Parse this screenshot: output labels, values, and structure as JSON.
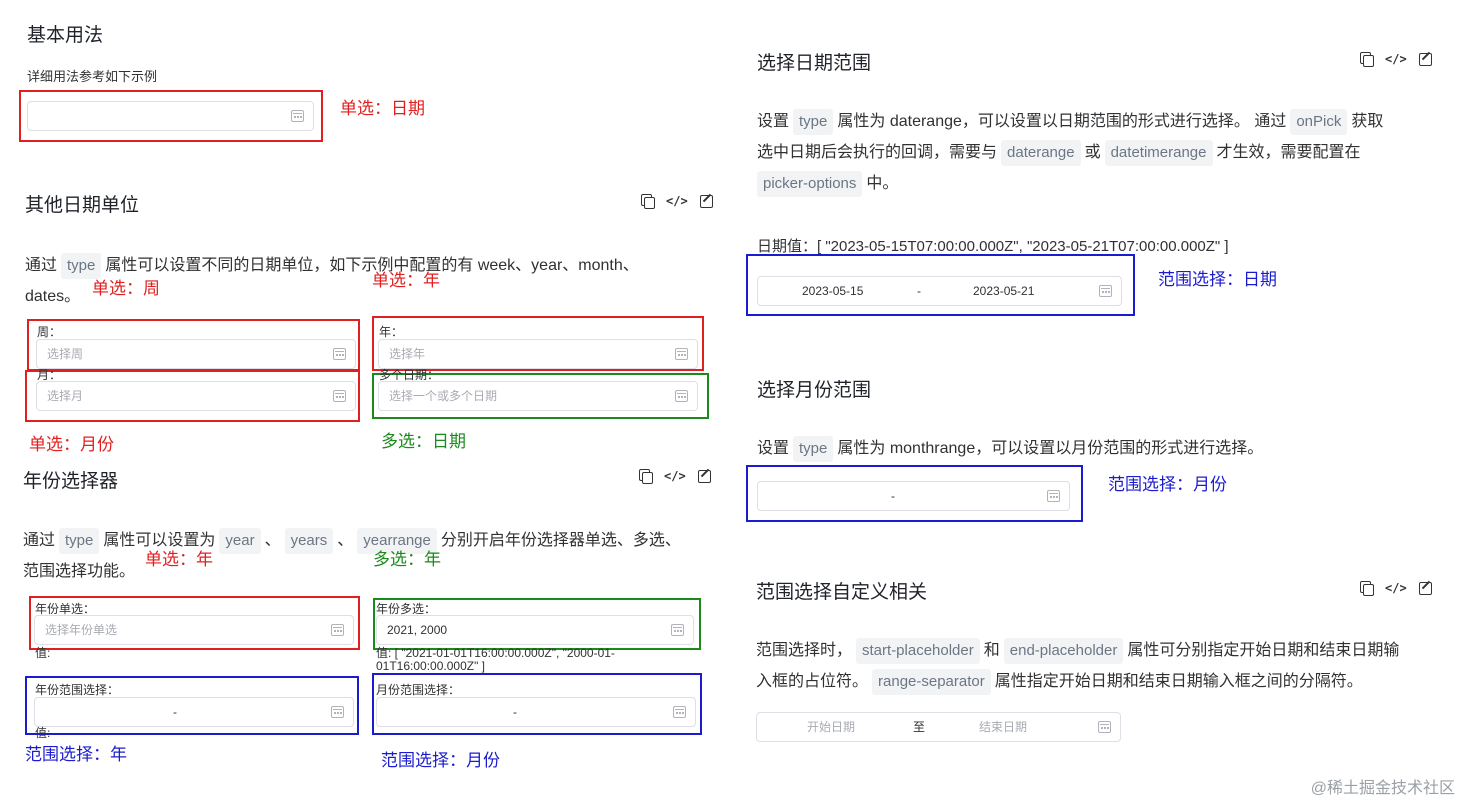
{
  "basic": {
    "title": "基本用法",
    "desc": "详细用法参考如下示例",
    "ann": "单选：日期"
  },
  "other_units": {
    "title": "其他日期单位",
    "desc_prefix": "通过",
    "desc_code": "type",
    "desc_rest": "属性可以设置不同的日期单位，如下示例中配置的有 week、year、month、",
    "desc_line2": "dates。",
    "week_label": "周：",
    "week_placeholder": "选择周",
    "year_label": "年：",
    "year_placeholder": "选择年",
    "month_label": "月：",
    "month_placeholder": "选择月",
    "dates_label": "多个日期：",
    "dates_placeholder": "选择一个或多个日期",
    "ann_week": "单选：周",
    "ann_year": "单选：年",
    "ann_month": "单选：月份",
    "ann_dates": "多选：日期"
  },
  "year_picker": {
    "title": "年份选择器",
    "desc_prefix": "通过",
    "code_type": "type",
    "desc_mid": "属性可以设置为",
    "code_year": "year",
    "sep1": "、",
    "code_years": "years",
    "sep2": "、",
    "code_yearrange": "yearrange",
    "desc_rest": "分别开启年份选择器单选、多选、",
    "desc_line2": "范围选择功能。",
    "single_label": "年份单选：",
    "single_placeholder": "选择年份单选",
    "single_value_label": "值:",
    "multi_label": "年份多选：",
    "multi_value": "2021, 2000",
    "multi_value_text": "值: [ \"2021-01-01T16:00:00.000Z\", \"2000-01-01T16:00:00.000Z\" ]",
    "range_label": "年份范围选择：",
    "range_sep": "-",
    "range_value_label": "值:",
    "month_range_label": "月份范围选择：",
    "month_range_sep": "-",
    "ann_single": "单选：年",
    "ann_multi": "多选：年",
    "ann_range": "范围选择：年",
    "ann_month_range": "范围选择：月份"
  },
  "daterange": {
    "title": "选择日期范围",
    "d1": "设置",
    "c1": "type",
    "d2": "属性为 daterange，可以设置以日期范围的形式进行选择。 通过",
    "c2": "onPick",
    "d3": "获取",
    "d4": "选中日期后会执行的回调，需要与",
    "c3": "daterange",
    "d5": "或",
    "c4": "datetimerange",
    "d6": "才生效，需要配置在",
    "c5": "picker-options",
    "d7": "中。",
    "value_text": "日期值：[ \"2023-05-15T07:00:00.000Z\", \"2023-05-21T07:00:00.000Z\" ]",
    "start": "2023-05-15",
    "sep": "-",
    "end": "2023-05-21",
    "ann": "范围选择：日期"
  },
  "monthrange": {
    "title": "选择月份范围",
    "d1": "设置",
    "c1": "type",
    "d2": "属性为 monthrange，可以设置以月份范围的形式进行选择。",
    "sep": "-",
    "ann": "范围选择：月份"
  },
  "custom_range": {
    "title": "范围选择自定义相关",
    "d1": "范围选择时，",
    "c1": "start-placeholder",
    "d2": "和",
    "c2": "end-placeholder",
    "d3": "属性可分别指定开始日期和结束日期输",
    "d4": "入框的占位符。",
    "c3": "range-separator",
    "d5": "属性指定开始日期和结束日期输入框之间的分隔符。",
    "start_placeholder": "开始日期",
    "separator": "至",
    "end_placeholder": "结束日期"
  },
  "watermark": "@稀土掘金技术社区",
  "colors": {
    "red": "#e02020",
    "green": "#1a8a1a",
    "blue": "#1c1ccf"
  },
  "icons": [
    "copy-icon",
    "code-icon",
    "edit-icon",
    "calendar-icon"
  ]
}
